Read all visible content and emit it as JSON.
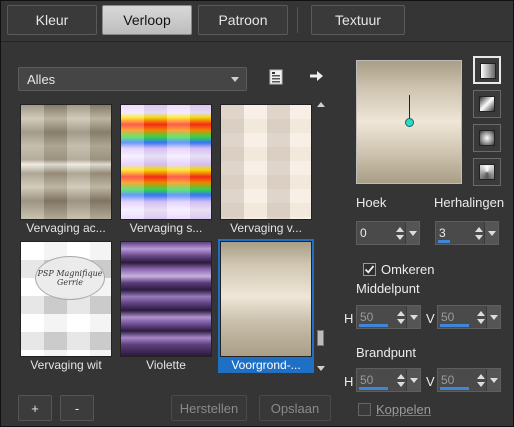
{
  "tabs": [
    {
      "label": "Kleur"
    },
    {
      "label": "Verloop"
    },
    {
      "label": "Patroon"
    },
    {
      "label": "Textuur"
    }
  ],
  "active_tab": "Verloop",
  "category": {
    "selected": "Alles"
  },
  "gradients": [
    {
      "caption": "Vervaging ac..."
    },
    {
      "caption": "Vervaging s..."
    },
    {
      "caption": "Vervaging v..."
    },
    {
      "caption": "Vervaging wit"
    },
    {
      "caption": "Violette"
    },
    {
      "caption": "Voorgrond-..."
    }
  ],
  "watermark": {
    "line1": "PSP Magnifique",
    "line2": "Gerrie"
  },
  "bottom": {
    "add": "+",
    "remove": "-",
    "reset": "Herstellen",
    "save": "Opslaan"
  },
  "settings": {
    "angle_label": "Hoek",
    "angle_value": "0",
    "repeats_label": "Herhalingen",
    "repeats_value": "3",
    "invert_label": "Omkeren",
    "invert_checked": true,
    "center_label": "Middelpunt",
    "focal_label": "Brandpunt",
    "h_label": "H",
    "v_label": "V",
    "center_h": "50",
    "center_v": "50",
    "focal_h": "50",
    "focal_v": "50",
    "link_label": "Koppelen",
    "link_checked": false
  },
  "colors": {
    "accent": "#1f6fc5",
    "tan": "#a99e86",
    "cream": "#efe6d8",
    "dark": "#353535"
  }
}
